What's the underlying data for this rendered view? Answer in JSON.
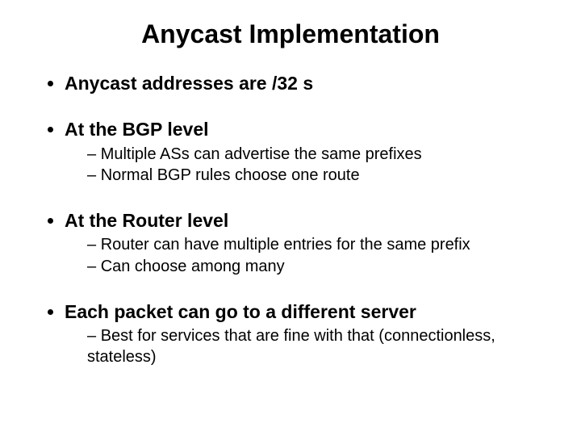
{
  "title": "Anycast Implementation",
  "bullets": {
    "b0": {
      "text": "Anycast addresses are /32 s"
    },
    "b1": {
      "text": "At the BGP level",
      "sub": {
        "s0": "Multiple ASs can advertise the same prefixes",
        "s1": "Normal BGP rules choose one route"
      }
    },
    "b2": {
      "text": "At the Router level",
      "sub": {
        "s0": "Router can have multiple entries for the same prefix",
        "s1": "Can choose among many"
      }
    },
    "b3": {
      "text": "Each packet can go to a different server",
      "sub": {
        "s0": "Best for services that are fine with that (connectionless, stateless)"
      }
    }
  }
}
